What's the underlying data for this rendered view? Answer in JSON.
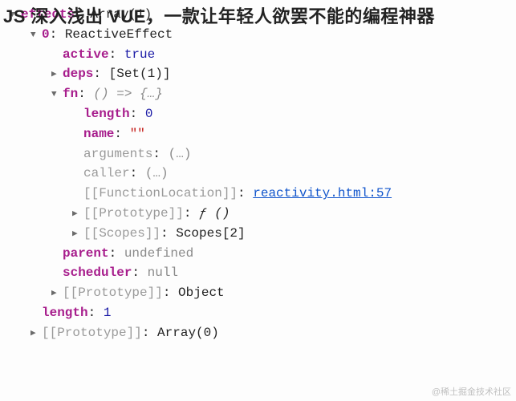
{
  "overlay_title": "JS 深入浅出 VUE，一款让年轻人欲罢不能的编程神器",
  "watermark": "@稀土掘金技术社区",
  "root": {
    "key": "effects",
    "val": "Array(1)"
  },
  "item0": {
    "key": "0",
    "val": "ReactiveEffect"
  },
  "active": {
    "key": "active",
    "val": "true"
  },
  "deps": {
    "key": "deps",
    "val": "[Set(1)]"
  },
  "fn": {
    "key": "fn",
    "val": "() => {…}"
  },
  "fn_length": {
    "key": "length",
    "val": "0"
  },
  "fn_name": {
    "key": "name",
    "val": "\"\""
  },
  "fn_arguments": {
    "key": "arguments",
    "val": "(…)"
  },
  "fn_caller": {
    "key": "caller",
    "val": "(…)"
  },
  "fn_loc": {
    "key": "[[FunctionLocation]]",
    "val": "reactivity.html:57"
  },
  "fn_proto": {
    "key": "[[Prototype]]",
    "val": "ƒ ()"
  },
  "fn_scopes": {
    "key": "[[Scopes]]",
    "val": "Scopes[2]"
  },
  "parent": {
    "key": "parent",
    "val": "undefined"
  },
  "scheduler": {
    "key": "scheduler",
    "val": "null"
  },
  "item_proto": {
    "key": "[[Prototype]]",
    "val": "Object"
  },
  "length": {
    "key": "length",
    "val": "1"
  },
  "arr_proto": {
    "key": "[[Prototype]]",
    "val": "Array(0)"
  }
}
